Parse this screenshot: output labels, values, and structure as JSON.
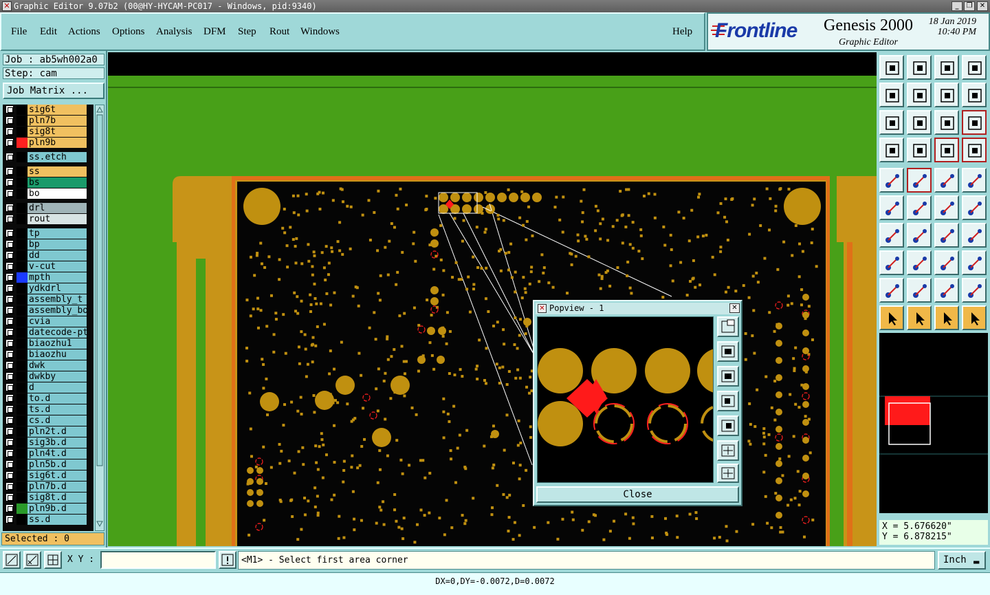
{
  "window": {
    "title": "Graphic Editor 9.07b2 (00@HY-HYCAM-PC017 - Windows, pid:9340)",
    "minimize": "_",
    "maximize": "❐",
    "close": "✕"
  },
  "menu": {
    "items": [
      "File",
      "Edit",
      "Actions",
      "Options",
      "Analysis",
      "DFM",
      "Step",
      "Rout",
      "Windows"
    ],
    "help": "Help"
  },
  "logo": {
    "brand": "Frontline",
    "product": "Genesis 2000",
    "subtitle": "Graphic Editor",
    "date": "18 Jan 2019",
    "time": "10:40 PM"
  },
  "job": {
    "job_label": "Job : ab5wh002a0",
    "step_label": "Step: cam",
    "matrix_button": "Job Matrix ..."
  },
  "layers": [
    {
      "name": "sig6t",
      "color": "#f0c060",
      "swatch": "#000"
    },
    {
      "name": "pln7b",
      "color": "#f0c060",
      "swatch": "#000"
    },
    {
      "name": "sig8t",
      "color": "#f0c060",
      "swatch": "#000"
    },
    {
      "name": "pln9b",
      "color": "#f0c060",
      "swatch": "#ff2020",
      "active": true
    },
    {
      "name": "ss.etch",
      "color": "#7fc8d0",
      "swatch": "#000",
      "gap": true
    },
    {
      "name": "ss",
      "color": "#f0c060",
      "swatch": "#000",
      "gap": true
    },
    {
      "name": "bs",
      "color": "#1a9a6a",
      "swatch": "#000"
    },
    {
      "name": "bo",
      "color": "#ffffff",
      "swatch": "#000"
    },
    {
      "name": "drl",
      "color": "#a0b4b8",
      "swatch": "#000",
      "gap": true
    },
    {
      "name": "rout",
      "color": "#d8e4e4",
      "swatch": "#000"
    },
    {
      "name": "tp",
      "color": "#7fc8d0",
      "swatch": "#000",
      "gap": true
    },
    {
      "name": "bp",
      "color": "#7fc8d0",
      "swatch": "#000"
    },
    {
      "name": "dd",
      "color": "#7fc8d0",
      "swatch": "#000"
    },
    {
      "name": "v-cut",
      "color": "#7fc8d0",
      "swatch": "#000"
    },
    {
      "name": "mpth",
      "color": "#7fc8d0",
      "swatch": "#1a3aff"
    },
    {
      "name": "ydkdrl",
      "color": "#7fc8d0",
      "swatch": "#000"
    },
    {
      "name": "assembly_t",
      "color": "#7fc8d0",
      "swatch": "#000"
    },
    {
      "name": "assembly_bo",
      "color": "#7fc8d0",
      "swatch": "#000"
    },
    {
      "name": "cvia",
      "color": "#7fc8d0",
      "swatch": "#000"
    },
    {
      "name": "datecode-pt",
      "color": "#7fc8d0",
      "swatch": "#000"
    },
    {
      "name": "biaozhu1",
      "color": "#7fc8d0",
      "swatch": "#000"
    },
    {
      "name": "biaozhu",
      "color": "#7fc8d0",
      "swatch": "#000"
    },
    {
      "name": "dwk",
      "color": "#7fc8d0",
      "swatch": "#000"
    },
    {
      "name": "dwkby",
      "color": "#7fc8d0",
      "swatch": "#000"
    },
    {
      "name": "d",
      "color": "#7fc8d0",
      "swatch": "#000"
    },
    {
      "name": "to.d",
      "color": "#7fc8d0",
      "swatch": "#000"
    },
    {
      "name": "ts.d",
      "color": "#7fc8d0",
      "swatch": "#000"
    },
    {
      "name": "cs.d",
      "color": "#7fc8d0",
      "swatch": "#000"
    },
    {
      "name": "pln2t.d",
      "color": "#7fc8d0",
      "swatch": "#000"
    },
    {
      "name": "sig3b.d",
      "color": "#7fc8d0",
      "swatch": "#000"
    },
    {
      "name": "pln4t.d",
      "color": "#7fc8d0",
      "swatch": "#000"
    },
    {
      "name": "pln5b.d",
      "color": "#7fc8d0",
      "swatch": "#000"
    },
    {
      "name": "sig6t.d",
      "color": "#7fc8d0",
      "swatch": "#000"
    },
    {
      "name": "pln7b.d",
      "color": "#7fc8d0",
      "swatch": "#000"
    },
    {
      "name": "sig8t.d",
      "color": "#7fc8d0",
      "swatch": "#000"
    },
    {
      "name": "pln9b.d",
      "color": "#7fc8d0",
      "swatch": "#2a9a2a"
    },
    {
      "name": "ss.d",
      "color": "#7fc8d0",
      "swatch": "#000"
    }
  ],
  "selected": "Selected : 0",
  "popview": {
    "title": "Popview - 1",
    "close_button": "Close"
  },
  "coords": {
    "x": "X = 5.676620\"",
    "y": "Y = 6.878215\""
  },
  "bottom": {
    "xy_label": "X Y :",
    "xy_value": "",
    "prompt": "<M1> - Select first area corner",
    "units": "Inch"
  },
  "status": "DX=0,DY=-0.0072,D=0.0072"
}
